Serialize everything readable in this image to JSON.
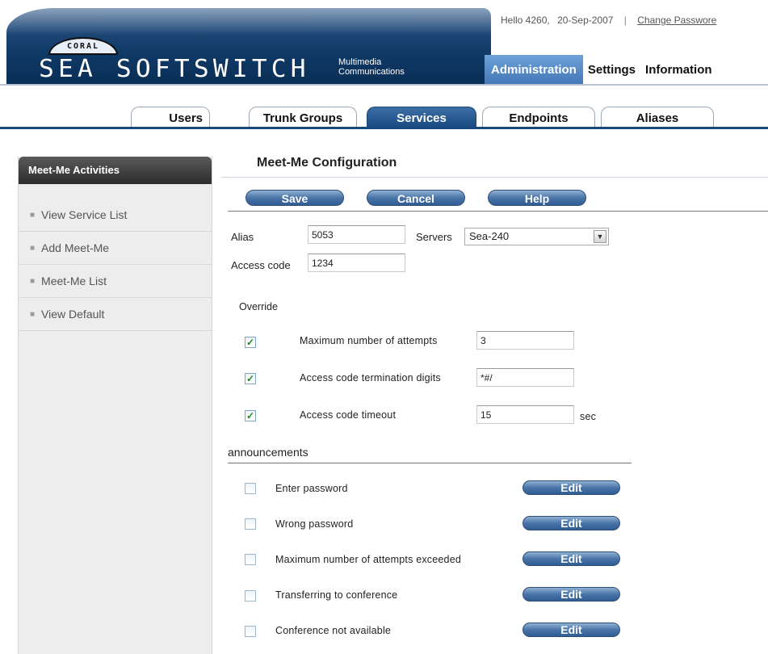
{
  "header": {
    "logo_badge": "CORAL",
    "brand_name": "SEA SOFTSWITCH",
    "tagline_line1": "Multimedia",
    "tagline_line2": "Communications",
    "greeting": "Hello 4260,",
    "date": "20-Sep-2007",
    "separator": "|",
    "change_password": "Change Passwore"
  },
  "main_nav": {
    "items": [
      {
        "label": "Administration",
        "active": true
      },
      {
        "label": "Settings",
        "active": false
      },
      {
        "label": "Information",
        "active": false
      }
    ]
  },
  "sub_tabs": [
    {
      "label": "Users",
      "active": false
    },
    {
      "label": "Trunk Groups",
      "active": false
    },
    {
      "label": "Services",
      "active": true
    },
    {
      "label": "Endpoints",
      "active": false
    },
    {
      "label": "Aliases",
      "active": false
    }
  ],
  "sidebar": {
    "title": "Meet-Me Activities",
    "items": [
      {
        "label": "View Service List"
      },
      {
        "label": "Add Meet-Me"
      },
      {
        "label": "Meet-Me List"
      },
      {
        "label": "View Default"
      }
    ]
  },
  "content": {
    "title": "Meet-Me Configuration",
    "buttons": {
      "save": "Save",
      "cancel": "Cancel",
      "help": "Help"
    },
    "alias": {
      "label": "Alias",
      "value": "5053"
    },
    "servers": {
      "label": "Servers",
      "selected": "Sea-240"
    },
    "access_code": {
      "label": "Access code",
      "value": "1234"
    },
    "override": {
      "label": "Override",
      "options": [
        {
          "label": "Maximum number of attempts",
          "checked": true,
          "value": "3",
          "unit": ""
        },
        {
          "label": "Access code termination digits",
          "checked": true,
          "value": "*#/",
          "unit": ""
        },
        {
          "label": "Access code timeout",
          "checked": true,
          "value": "15",
          "unit": "sec"
        }
      ]
    },
    "announcements": {
      "title": "announcements",
      "edit_label": "Edit",
      "items": [
        {
          "label": "Enter password",
          "checked": false
        },
        {
          "label": "Wrong password",
          "checked": false
        },
        {
          "label": "Maximum number of attempts exceeded",
          "checked": false
        },
        {
          "label": "Transferring to conference",
          "checked": false
        },
        {
          "label": "Conference not available",
          "checked": false
        }
      ]
    }
  },
  "colors": {
    "nav_dark": "#17497f",
    "nav_active": "#4a7bb8",
    "sidebar_header": "#333333",
    "check_green": "#1a8a1a"
  }
}
